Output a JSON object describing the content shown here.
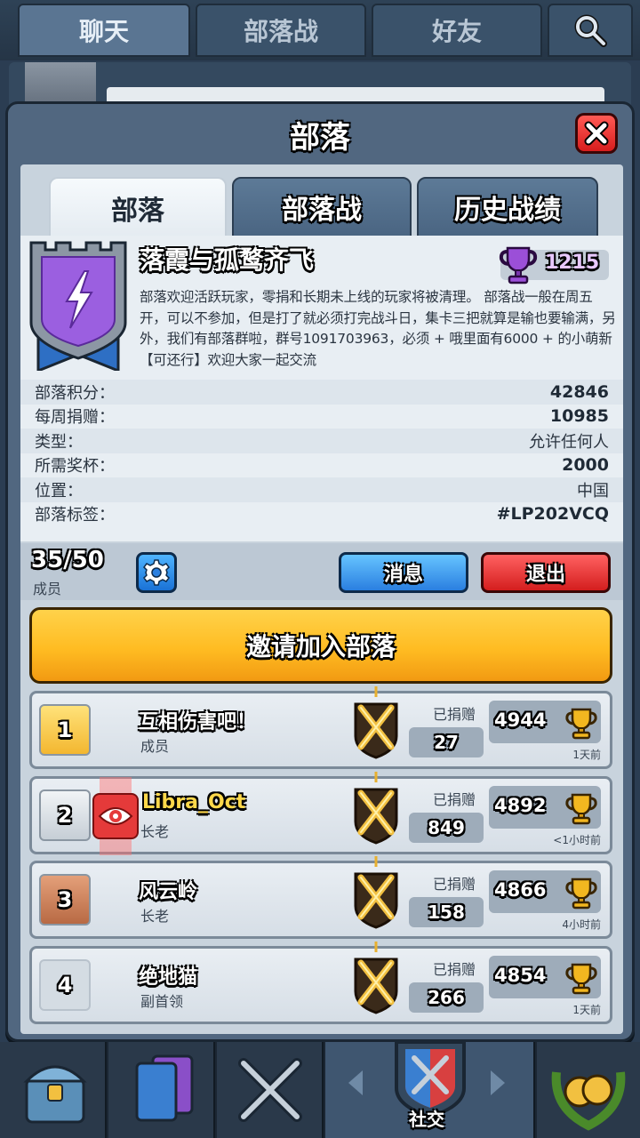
{
  "top_tabs": [
    {
      "label": "聊天"
    },
    {
      "label": "部落战"
    },
    {
      "label": "好友"
    }
  ],
  "modal": {
    "title": "部落",
    "tabs": [
      {
        "label": "部落"
      },
      {
        "label": "部落战"
      },
      {
        "label": "历史战绩"
      }
    ]
  },
  "clan": {
    "name": "落霞与孤鹜齐飞",
    "trophies": "1215",
    "description": "部落欢迎活跃玩家，零捐和长期未上线的玩家将被清理。 部落战一般在周五开，可以不参加，但是打了就必须打完战斗日，集卡三把就算是输也要输满，另外，我们有部落群啦，群号1091703963，必须 + 哦里面有6000 + 的小萌新【可还行】欢迎大家一起交流",
    "stats": [
      {
        "label": "部落积分：",
        "value": "42846",
        "bold": true
      },
      {
        "label": "每周捐赠：",
        "value": "10985",
        "bold": true
      },
      {
        "label": "类型：",
        "value": "允许任何人",
        "bold": false
      },
      {
        "label": "所需奖杯：",
        "value": "2000",
        "bold": true
      },
      {
        "label": "位置：",
        "value": "中国",
        "bold": false
      },
      {
        "label": "部落标签：",
        "value": "#LP202VCQ",
        "bold": true
      }
    ]
  },
  "member_bar": {
    "count": "35/50",
    "label": "成员",
    "message_button": "消息",
    "leave_button": "退出"
  },
  "invite_button": "邀请加入部落",
  "members": [
    {
      "rank": "1",
      "name": "互相伤害吧！",
      "role": "成员",
      "donated_label": "已捐赠",
      "donated": "27",
      "trophies": "4944",
      "last_seen": "1天前"
    },
    {
      "rank": "2",
      "name": "Libra_Oct",
      "role": "长老",
      "donated_label": "已捐赠",
      "donated": "849",
      "trophies": "4892",
      "last_seen": "<1小时前"
    },
    {
      "rank": "3",
      "name": "风云岭",
      "role": "长老",
      "donated_label": "已捐赠",
      "donated": "158",
      "trophies": "4866",
      "last_seen": "4小时前"
    },
    {
      "rank": "4",
      "name": "绝地猫",
      "role": "副首领",
      "donated_label": "已捐赠",
      "donated": "266",
      "trophies": "4854",
      "last_seen": "1天前"
    }
  ],
  "bottom_nav": {
    "active_label": "社交"
  },
  "colors": {
    "accent_gold": "#ffbc22",
    "button_blue": "#2a7fe0",
    "button_red": "#d41e1e",
    "modal_blue": "#516780"
  }
}
